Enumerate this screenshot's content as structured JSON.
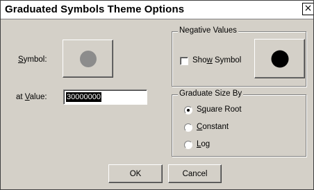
{
  "window": {
    "title": "Graduated Symbols Theme Options",
    "close_glyph": "×"
  },
  "symbol": {
    "label": "Symbol:",
    "accel": "S",
    "rest": "ymbol:",
    "swatch_color": "#8c8c8c"
  },
  "at_value": {
    "label_pre": "at ",
    "accel": "V",
    "rest": "alue:",
    "value": "30000000"
  },
  "negative": {
    "group_title": "Negative Values",
    "show_pre": "Sho",
    "show_accel": "w",
    "show_rest": " Symbol",
    "show_checked": false,
    "swatch_color": "#000000"
  },
  "graduate": {
    "group_title": "Graduate Size By",
    "options": [
      {
        "pre": "S",
        "accel": "q",
        "rest": "uare Root",
        "checked": true
      },
      {
        "pre": "",
        "accel": "C",
        "rest": "onstant",
        "checked": false
      },
      {
        "pre": "",
        "accel": "L",
        "rest": "og",
        "checked": false
      }
    ]
  },
  "buttons": {
    "ok": "OK",
    "cancel": "Cancel"
  }
}
